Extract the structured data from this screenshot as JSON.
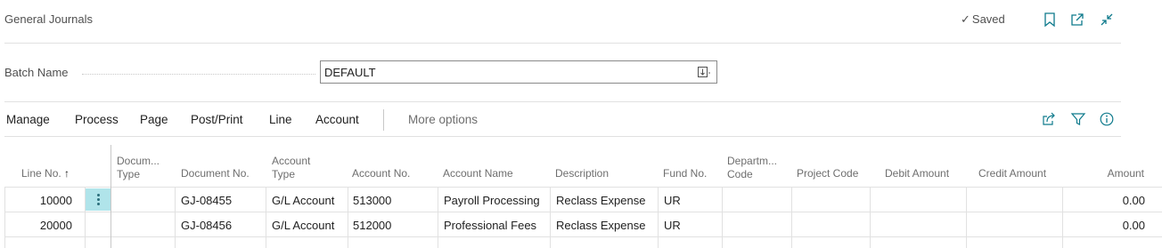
{
  "header": {
    "title": "General Journals",
    "saved_label": "Saved"
  },
  "batch": {
    "label": "Batch Name",
    "value": "DEFAULT"
  },
  "actions": {
    "menu": [
      "Manage",
      "Process",
      "Page",
      "Post/Print",
      "Line",
      "Account"
    ],
    "more": "More options"
  },
  "table": {
    "columns": {
      "line_no": "Line No.",
      "line_no_sort": "↑",
      "doc_type_1": "Docum...",
      "doc_type_2": "Type",
      "doc_no": "Document No.",
      "acct_type_1": "Account",
      "acct_type_2": "Type",
      "acct_no": "Account No.",
      "acct_name": "Account Name",
      "description": "Description",
      "fund_no": "Fund No.",
      "dept_1": "Departm...",
      "dept_2": "Code",
      "project": "Project Code",
      "debit": "Debit Amount",
      "credit": "Credit Amount",
      "amount": "Amount"
    },
    "rows": [
      {
        "line_no": "10000",
        "doc_type": "",
        "doc_no": "GJ-08455",
        "acct_type": "G/L Account",
        "acct_no": "513000",
        "acct_name": "Payroll Processing",
        "description": "Reclass Expense",
        "fund_no": "UR",
        "dept": "",
        "project": "",
        "debit": "",
        "credit": "",
        "amount": "0.00"
      },
      {
        "line_no": "20000",
        "doc_type": "",
        "doc_no": "GJ-08456",
        "acct_type": "G/L Account",
        "acct_no": "512000",
        "acct_name": "Professional Fees",
        "description": "Reclass Expense",
        "fund_no": "UR",
        "dept": "",
        "project": "",
        "debit": "",
        "credit": "",
        "amount": "0.00"
      }
    ]
  },
  "colors": {
    "accent": "#0e7a8c",
    "selected_cell": "#b0e4ea"
  }
}
